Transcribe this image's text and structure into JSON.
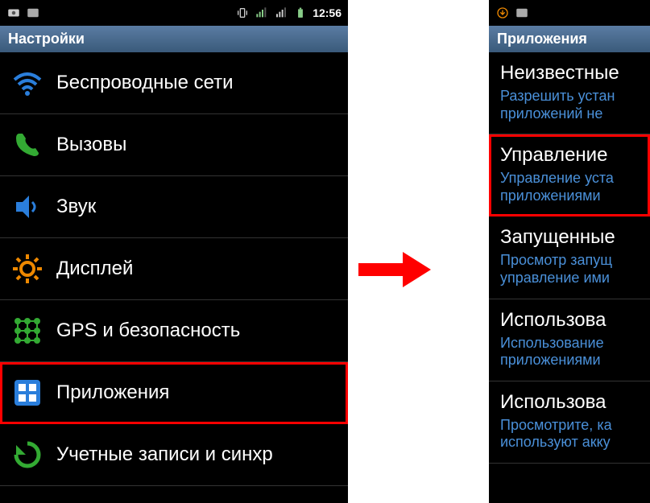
{
  "left": {
    "status": {
      "time": "12:56"
    },
    "header": "Настройки",
    "items": [
      {
        "label": "Беспроводные сети",
        "icon": "wifi",
        "highlighted": false
      },
      {
        "label": "Вызовы",
        "icon": "phone",
        "highlighted": false
      },
      {
        "label": "Звук",
        "icon": "speaker",
        "highlighted": false
      },
      {
        "label": "Дисплей",
        "icon": "gear",
        "highlighted": false
      },
      {
        "label": "GPS и безопасность",
        "icon": "grid-green",
        "highlighted": false
      },
      {
        "label": "Приложения",
        "icon": "apps",
        "highlighted": true
      },
      {
        "label": "Учетные записи и синхр",
        "icon": "sync",
        "highlighted": false
      }
    ]
  },
  "right": {
    "header": "Приложения",
    "items": [
      {
        "title": "Неизвестные",
        "sub1": "Разрешить устан",
        "sub2": "приложений не",
        "highlighted": false
      },
      {
        "title": "Управление",
        "sub1": "Управление уста",
        "sub2": "приложениями",
        "highlighted": true
      },
      {
        "title": "Запущенные",
        "sub1": "Просмотр запущ",
        "sub2": "управление ими",
        "highlighted": false
      },
      {
        "title": "Использова",
        "sub1": "Использование",
        "sub2": "приложениями",
        "highlighted": false
      },
      {
        "title": "Использова",
        "sub1": "Просмотрите, ка",
        "sub2": "используют акку",
        "highlighted": false
      }
    ]
  }
}
